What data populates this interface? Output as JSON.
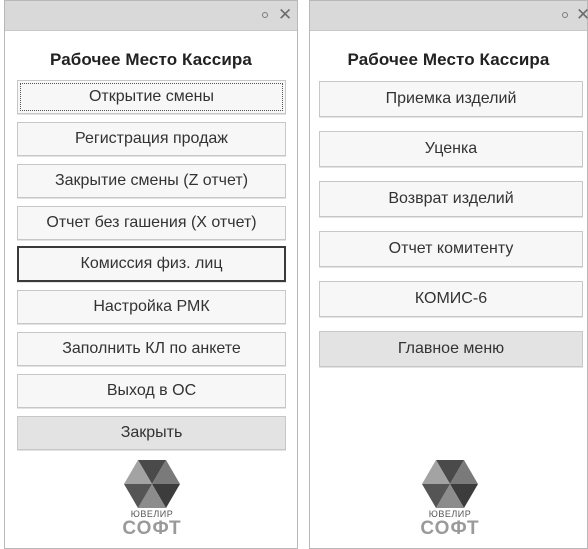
{
  "left_panel": {
    "title": "Рабочее Место Кассира",
    "buttons": [
      {
        "label": "Открытие смены"
      },
      {
        "label": "Регистрация продаж"
      },
      {
        "label": "Закрытие смены (Z отчет)"
      },
      {
        "label": "Отчет без гашения (X отчет)"
      },
      {
        "label": "Комиссия физ. лиц"
      },
      {
        "label": "Настройка РМК"
      },
      {
        "label": "Заполнить КЛ по анкете"
      },
      {
        "label": "Выход в ОС"
      },
      {
        "label": "Закрыть"
      }
    ],
    "logo": {
      "line1": "ЮВЕЛИР",
      "line2": "СОФТ"
    }
  },
  "right_panel": {
    "title": "Рабочее Место Кассира",
    "buttons": [
      {
        "label": "Приемка изделий"
      },
      {
        "label": "Уценка"
      },
      {
        "label": "Возврат изделий"
      },
      {
        "label": "Отчет комитенту"
      },
      {
        "label": "КОМИС-6"
      },
      {
        "label": "Главное меню"
      }
    ],
    "logo": {
      "line1": "ЮВЕЛИР",
      "line2": "СОФТ"
    }
  },
  "icons": {
    "window_close": "close-icon",
    "window_pin": "pin-icon",
    "logo": "hexagon-logo-icon"
  }
}
